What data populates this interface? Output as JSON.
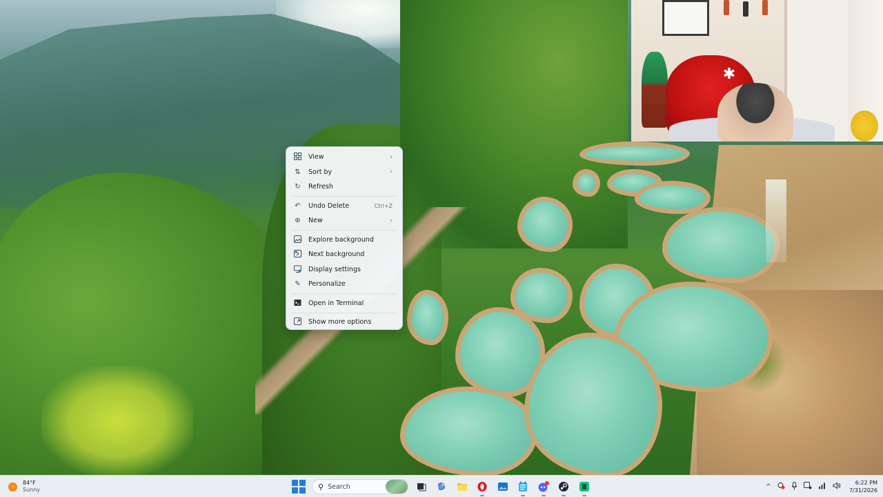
{
  "context_menu": {
    "items": [
      {
        "label": "View",
        "icon": "grid-icon",
        "submenu": true
      },
      {
        "label": "Sort by",
        "icon": "sort-icon",
        "submenu": true
      },
      {
        "label": "Refresh",
        "icon": "refresh-icon"
      },
      {
        "label": "Undo Delete",
        "icon": "undo-icon",
        "shortcut": "Ctrl+Z"
      },
      {
        "label": "New",
        "icon": "plus-circle-icon",
        "submenu": true
      },
      {
        "label": "Explore background",
        "icon": "image-icon"
      },
      {
        "label": "Next background",
        "icon": "next-image-icon"
      },
      {
        "label": "Display settings",
        "icon": "display-icon"
      },
      {
        "label": "Personalize",
        "icon": "brush-icon"
      },
      {
        "label": "Open in Terminal",
        "icon": "terminal-icon"
      },
      {
        "label": "Show more options",
        "icon": "more-options-icon"
      }
    ]
  },
  "taskbar": {
    "weather": {
      "temp": "84°F",
      "condition": "Sunny",
      "icon": "sun-icon",
      "color": "#f07f12"
    },
    "search_placeholder": "Search",
    "pinned_apps": [
      "task-view-icon",
      "copilot-icon",
      "file-explorer-icon",
      "opera-icon",
      "photos-icon",
      "notepad-icon",
      "discord-icon",
      "steam-icon",
      "app-icon"
    ],
    "tray": {
      "chevron": "^"
    },
    "clock": {
      "time": "6:22 PM",
      "date": "7/31/2026"
    }
  },
  "colors": {
    "accent": "#1f7fe0",
    "menu_bg": "#f3f6f8",
    "taskbar_bg": "#e9eef2"
  }
}
